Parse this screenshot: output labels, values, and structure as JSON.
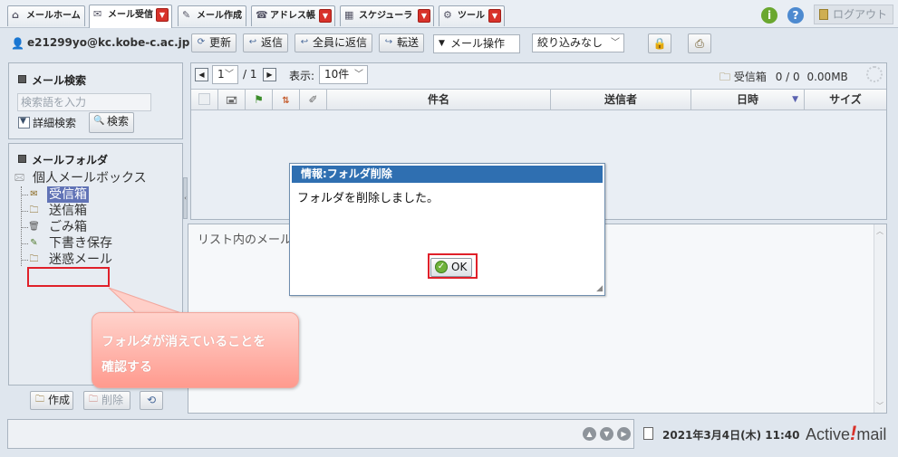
{
  "tabs": [
    {
      "label": "メールホーム",
      "icon": "home-icon"
    },
    {
      "label": "メール受信",
      "icon": "mail-receive-icon",
      "active": true
    },
    {
      "label": "メール作成",
      "icon": "compose-icon"
    },
    {
      "label": "アドレス帳",
      "icon": "address-book-icon"
    },
    {
      "label": "スケジューラ",
      "icon": "calendar-icon"
    },
    {
      "label": "ツール",
      "icon": "gear-icon"
    }
  ],
  "header": {
    "info_icon": "i",
    "help_icon": "?",
    "logout_label": "ログアウト"
  },
  "toolbar": {
    "user_email": "e21299yo@kc.kobe-c.ac.jp",
    "refresh_label": "更新",
    "reply_label": "返信",
    "reply_all_label": "全員に返信",
    "forward_label": "転送",
    "mail_ops_label": "メール操作",
    "filter_value": "絞り込みなし"
  },
  "search_pane": {
    "title": "メール検索",
    "placeholder": "検索語を入力",
    "detail_label": "詳細検索",
    "search_button": "検索"
  },
  "folder_pane": {
    "title": "メールフォルダ",
    "root": "個人メールボックス",
    "folders": [
      "受信箱",
      "送信箱",
      "ごみ箱",
      "下書き保存",
      "迷惑メール"
    ],
    "create_label": "作成",
    "delete_label": "削除"
  },
  "list": {
    "page_current": "1",
    "page_total": "/ 1",
    "display_label": "表示:",
    "display_value": "10件",
    "folder_name": "受信箱",
    "folder_count": "0 / 0",
    "folder_size": "0.00MB",
    "columns": [
      "件名",
      "送信者",
      "日時",
      "サイズ"
    ]
  },
  "preview": {
    "text": "リスト内のメール"
  },
  "status": {
    "datetime": "2021年3月4日(木) 11:40",
    "brand_left": "Active",
    "brand_mark": "!",
    "brand_right": "mail"
  },
  "dialog": {
    "title": "情報:フォルダ削除",
    "message": "フォルダを削除しました。",
    "ok_label": "OK"
  },
  "annotation": {
    "text": "フォルダが消えていることを\n確認する"
  },
  "colors": {
    "dialog_title": "#2f6fb1",
    "selected_folder": "#6173b6",
    "highlight": "#e0202a",
    "callout": "#ff9a8e",
    "tab_dropdown": "#d8322a"
  }
}
